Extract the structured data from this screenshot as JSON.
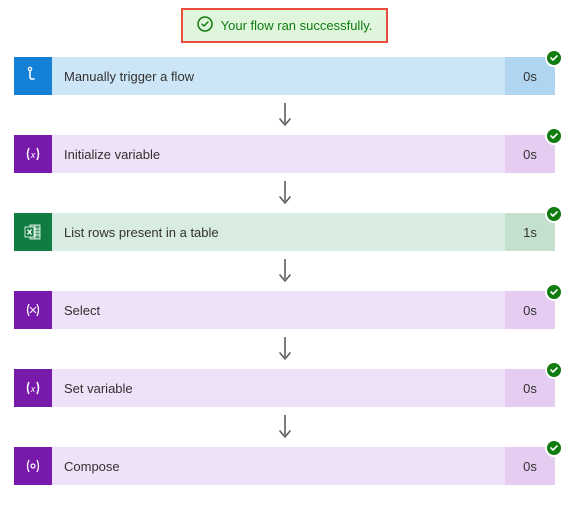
{
  "banner": {
    "text": "Your flow ran successfully."
  },
  "steps": [
    {
      "title": "Manually trigger a flow",
      "duration": "0s"
    },
    {
      "title": "Initialize variable",
      "duration": "0s"
    },
    {
      "title": "List rows present in a table",
      "duration": "1s"
    },
    {
      "title": "Select",
      "duration": "0s"
    },
    {
      "title": "Set variable",
      "duration": "0s"
    },
    {
      "title": "Compose",
      "duration": "0s"
    }
  ]
}
